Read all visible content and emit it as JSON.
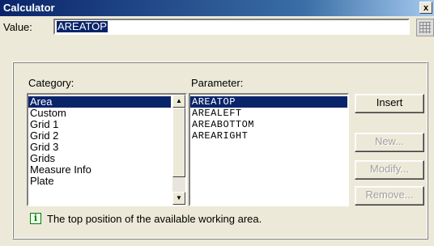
{
  "window": {
    "title": "Calculator",
    "close_glyph": "x"
  },
  "value": {
    "label": "Value:",
    "text": "AREATOP"
  },
  "category": {
    "label": "Category:",
    "items": [
      "Area",
      "Custom",
      "Grid 1",
      "Grid 2",
      "Grid 3",
      "Grids",
      "Measure Info",
      "Plate"
    ],
    "selected": "Area"
  },
  "parameter": {
    "label": "Parameter:",
    "items": [
      "AREATOP",
      "AREALEFT",
      "AREABOTTOM",
      "AREARIGHT"
    ],
    "selected": "AREATOP"
  },
  "buttons": {
    "insert": "Insert",
    "new": "New...",
    "modify": "Modify...",
    "remove": "Remove..."
  },
  "info": {
    "icon": "info-icon",
    "text": "The top position of the available working area."
  },
  "colors": {
    "title_bar": "#0a246a",
    "selection": "#0a246a",
    "info_icon": "#0b7a0b"
  }
}
